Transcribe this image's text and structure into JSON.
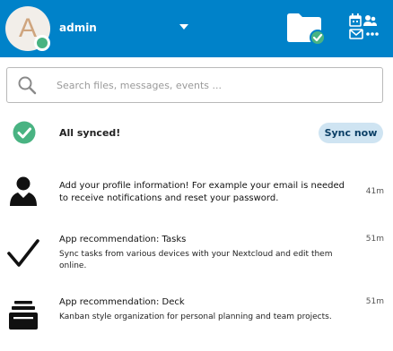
{
  "header": {
    "avatar_letter": "A",
    "account_name": "admin",
    "colors": {
      "bar": "#0082c9",
      "status_online": "#49b382",
      "synced": "#49b382"
    }
  },
  "search": {
    "placeholder": "Search files, messages, events ..."
  },
  "sync": {
    "status": "All synced!",
    "button": "Sync now"
  },
  "activities": [
    {
      "icon": "user-icon",
      "message": "Add your profile information! For example your email is needed to receive notifications and reset your password.",
      "subline": "",
      "time": "41m"
    },
    {
      "icon": "checkmark-icon",
      "message": "App recommendation: Tasks",
      "subline": "Sync tasks from various devices with your Nextcloud and edit them online.",
      "time": "51m"
    },
    {
      "icon": "deck-icon",
      "message": "App recommendation: Deck",
      "subline": "Kanban style organization for personal planning and team projects.",
      "time": "51m"
    }
  ]
}
